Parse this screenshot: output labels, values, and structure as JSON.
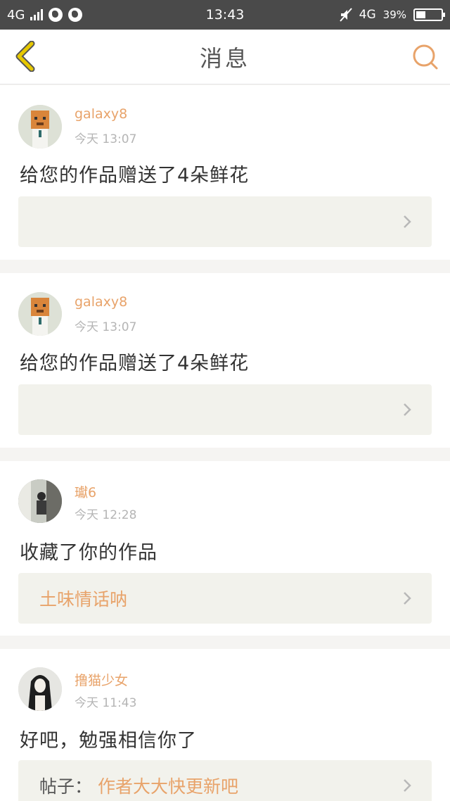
{
  "status_bar": {
    "network_left": "4G",
    "time": "13:43",
    "network_right": "4G",
    "battery": "39%"
  },
  "header": {
    "title": "消息",
    "back_icon": "chevron-left-icon",
    "search_icon": "search-icon"
  },
  "colors": {
    "accent": "#e8a36a",
    "back_arrow": "#d9b800",
    "quote_bg": "#f2f2ec"
  },
  "messages": [
    {
      "user": "galaxy8",
      "time": "今天 13:07",
      "text": "给您的作品赠送了4朵鲜花",
      "quote": "",
      "quote_prefix": ""
    },
    {
      "user": "galaxy8",
      "time": "今天 13:07",
      "text": "给您的作品赠送了4朵鲜花",
      "quote": "",
      "quote_prefix": ""
    },
    {
      "user": "瓛6",
      "time": "今天 12:28",
      "text": "收藏了你的作品",
      "quote": "土味情话呐",
      "quote_prefix": ""
    },
    {
      "user": "撸猫少女",
      "time": "今天 11:43",
      "text": "好吧，勉强相信你了",
      "quote": "作者大大快更新吧",
      "quote_prefix": "帖子："
    }
  ]
}
